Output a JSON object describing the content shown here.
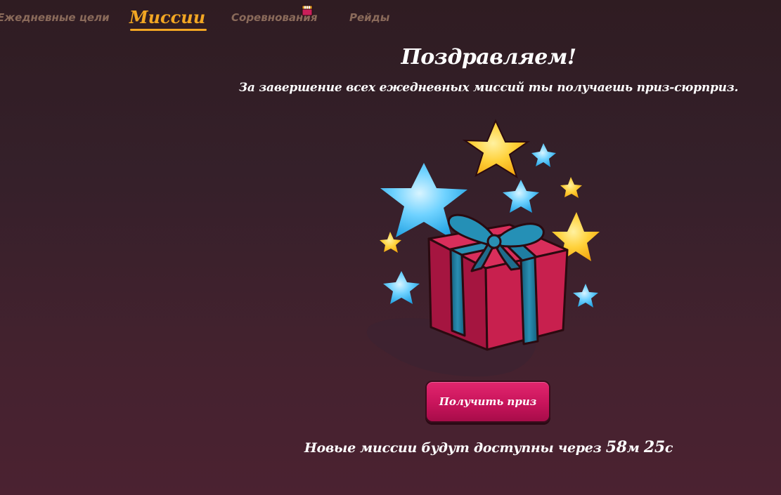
{
  "tabs": {
    "daily_goals": "Ежедневные цели",
    "missions": "Миссии",
    "competitions": "Соревнования",
    "raids": "Рейды"
  },
  "active_tab": "missions",
  "congrats": {
    "title": "Поздравляем!",
    "subtitle": "За завершение всех ежедневных миссий ты получаешь приз-сюрприз."
  },
  "claim_button": {
    "label": "Получить приз"
  },
  "timer": {
    "prefix": "Новые миссии будут доступны через",
    "minutes": "58",
    "minutes_unit": "м",
    "seconds": "25",
    "seconds_unit": "с"
  },
  "colors": {
    "accent": "#f2a623",
    "button": "#c8145b",
    "gift": "#c8204e",
    "ribbon": "#1f6c8c",
    "star_gold": "#ffc21a",
    "star_blue": "#45bff0"
  },
  "icons": {
    "competition_badge": "treasure-chest-icon",
    "illustration": "gift-box-with-stars"
  }
}
